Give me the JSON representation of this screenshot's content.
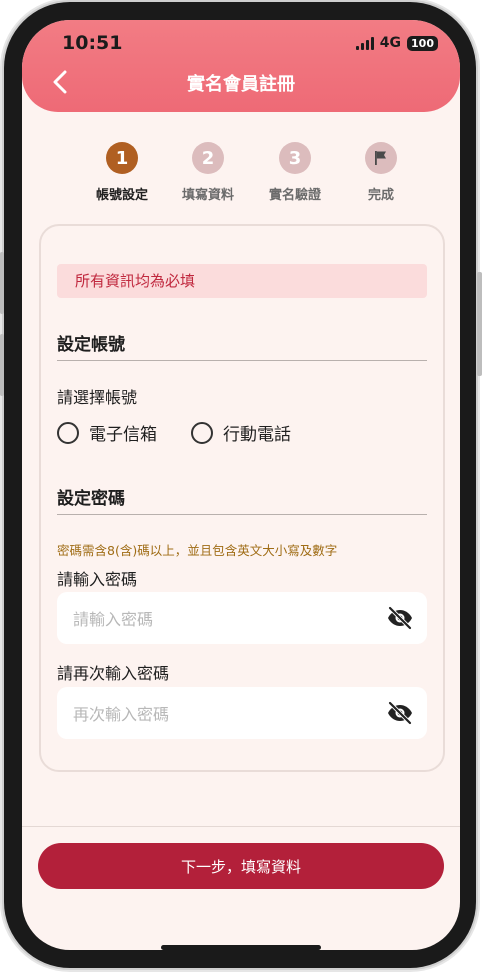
{
  "status_bar": {
    "time": "10:51",
    "network": "4G",
    "battery": "100"
  },
  "header": {
    "title": "實名會員註冊"
  },
  "steps": [
    {
      "number": "1",
      "label": "帳號設定",
      "state": "active"
    },
    {
      "number": "2",
      "label": "填寫資料",
      "state": "inactive"
    },
    {
      "number": "3",
      "label": "實名驗證",
      "state": "inactive"
    },
    {
      "number": "",
      "label": "完成",
      "state": "inactive",
      "icon": "flag-icon"
    }
  ],
  "colors": {
    "active_step": "#b05f22",
    "inactive_step": "#dcbcbd",
    "primary": "#b3203a",
    "header": "#ee6a76"
  },
  "form": {
    "notice": "所有資訊均為必填",
    "account_section": {
      "title": "設定帳號",
      "choose_label": "請選擇帳號",
      "options": [
        "電子信箱",
        "行動電話"
      ]
    },
    "password_section": {
      "title": "設定密碼",
      "hint": "密碼需含8(含)碼以上，並且包含英文大小寫及數字",
      "password_label": "請輸入密碼",
      "password_placeholder": "請輸入密碼",
      "confirm_label": "請再次輸入密碼",
      "confirm_placeholder": "再次輸入密碼"
    }
  },
  "footer": {
    "next_button": "下一步，填寫資料"
  }
}
